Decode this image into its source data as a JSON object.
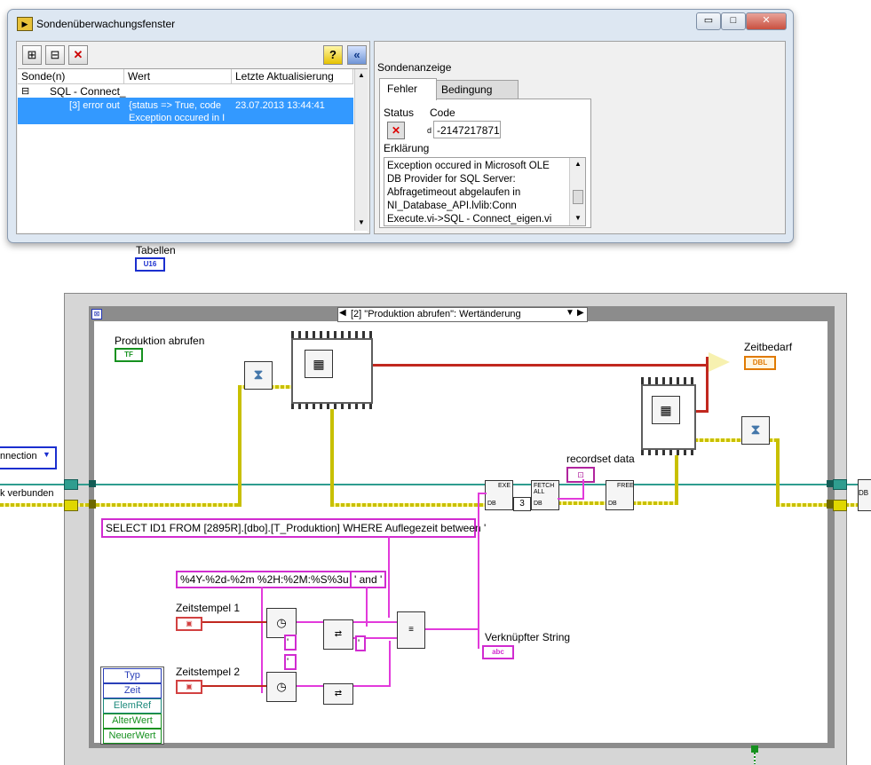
{
  "probe_window": {
    "title": "Sondenüberwachungsfenster",
    "window_buttons": {
      "minimize": "▭",
      "maximize": "□",
      "close": "✕"
    },
    "help_glyph": "?",
    "collapse_glyph": "«",
    "columns": [
      "Sonde(n)",
      "Wert",
      "Letzte Aktualisierung"
    ],
    "tree_toggle": "⊟",
    "tree_item": "SQL - Connect_",
    "selected_row": {
      "probe": "[3] error out",
      "value_line1": "{status => True, code",
      "value_line2": "Exception occured in I",
      "updated": "23.07.2013 13:44:41"
    },
    "display_title": "Sondenanzeige",
    "tabs": [
      "Fehler",
      "Bedingung"
    ],
    "status_label": "Status",
    "code_label": "Code",
    "code_prefix": "d",
    "code_value": "-2147217871",
    "explanation_label": "Erklärung",
    "explanation_text": "Exception occured in Microsoft OLE DB Provider for SQL Server: Abfragetimeout abgelaufen in NI_Database_API.lvlib:Conn Execute.vi->SQL - Connect_eigen.vi"
  },
  "diagram": {
    "tabellen_label": "Tabellen",
    "tabellen_type": "U16",
    "event_case": "[2] \"Produktion abrufen\": Wertänderung",
    "produktion_label": "Produktion abrufen",
    "produktion_type": "TF",
    "zeitbedarf_label": "Zeitbedarf",
    "zeitbedarf_type": "DBL",
    "recordset_label": "recordset data",
    "connection_label": "nnection",
    "verbunden_label": "k verbunden",
    "sql_string": "SELECT ID1 FROM [2895R].[dbo].[T_Produktion] WHERE Auflegezeit between '",
    "format_string": "%4Y-%2d-%2m %2H:%2M:%S%3u",
    "and_string": "' and '",
    "quote_small": "'",
    "zeitstempel1": "Zeitstempel 1",
    "zeitstempel2": "Zeitstempel 2",
    "verkn_label": "Verknüpfter String",
    "verkn_type": "abc",
    "exe_label": "EXE",
    "fetch_label": "FETCH ALL",
    "free_label": "FREE",
    "db_label": "DB",
    "const_3": "3",
    "event_data": [
      "Typ",
      "Zeit",
      "ElemRef",
      "AlterWert",
      "NeuerWert"
    ]
  },
  "colors": {
    "error_wire": "#c8c000",
    "string_wire": "#e23adb",
    "timestamp_wire": "#c1281f",
    "ref_wire": "#2f9d8f",
    "selection": "#3399ff"
  }
}
